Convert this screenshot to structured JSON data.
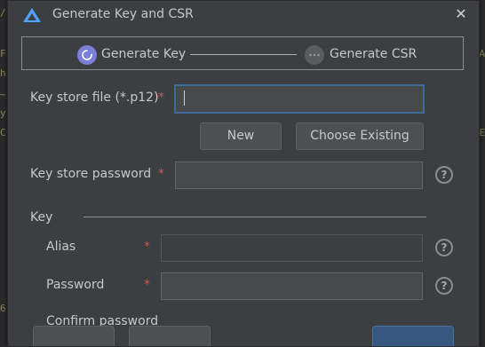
{
  "background": {
    "left_chars": [
      "/",
      "F",
      "h",
      "~",
      "y",
      "C",
      "6"
    ],
    "right_chars": [
      "A",
      "E"
    ]
  },
  "dialog": {
    "title": "Generate Key and CSR",
    "close_icon": "close-icon",
    "logo_icon": "harmony-logo-icon"
  },
  "steps": [
    {
      "label": "Generate Key",
      "icon": "refresh-icon",
      "state": "active",
      "color": "#7b7fd8"
    },
    {
      "label": "Generate CSR",
      "icon": "more-dots-icon",
      "state": "pending",
      "color": "#5a5d60"
    }
  ],
  "form": {
    "keystore_file": {
      "label": "Key store file (*.p12)",
      "required": "*",
      "value": ""
    },
    "buttons": {
      "new": "New",
      "choose_existing": "Choose Existing"
    },
    "keystore_password": {
      "label": "Key store password",
      "required": "*",
      "value": "",
      "help": "?"
    },
    "key_section": "Key",
    "alias": {
      "label": "Alias",
      "required": "*",
      "value": "",
      "help": "?"
    },
    "password": {
      "label": "Password",
      "required": "*",
      "value": "",
      "help": "?"
    },
    "next_partial": "Confirm password"
  },
  "colors": {
    "accent": "#3d6a99",
    "required": "#cc5555",
    "dialog_bg": "#3c3f41"
  }
}
